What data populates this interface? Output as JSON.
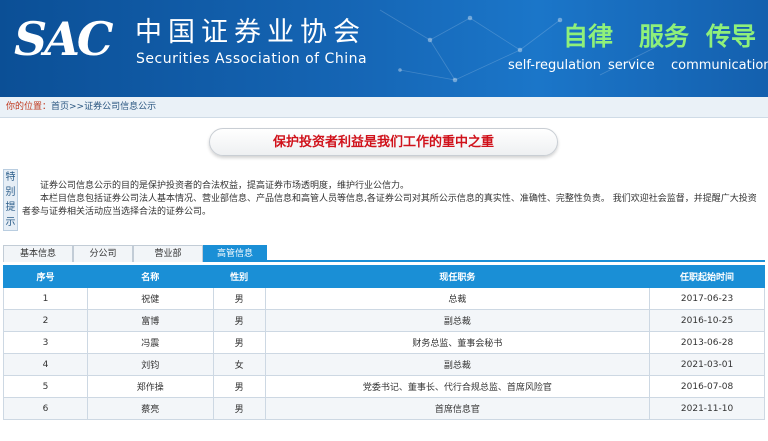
{
  "header": {
    "logo": "SAC",
    "name_cn": "中国证券业协会",
    "name_en": "Securities Association of China",
    "slogans": [
      {
        "cn": "自律",
        "en": "self-regulation"
      },
      {
        "cn": "服务",
        "en": "service"
      },
      {
        "cn": "传导",
        "en": "communication"
      }
    ]
  },
  "breadcrumb": {
    "prefix": "你的位置：",
    "path": "首页>>证券公司信息公示"
  },
  "motto": "保护投资者利益是我们工作的重中之重",
  "notice": {
    "tag": [
      "特",
      "别",
      "提",
      "示"
    ],
    "lines": [
      "证券公司信息公示的目的是保护投资者的合法权益，提高证券市场透明度，维护行业公信力。",
      "本栏目信息包括证券公司法人基本情况、营业部信息、产品信息和高管人员等信息,各证券公司对其所公示信息的真实性、准确性、完整性负责。 我们欢迎社会监督，并提醒广大投资者参与证券相关活动应当选择合法的证券公司。"
    ]
  },
  "tabs": [
    {
      "label": "基本信息",
      "active": false
    },
    {
      "label": "分公司",
      "active": false
    },
    {
      "label": "营业部",
      "active": false
    },
    {
      "label": "高管信息",
      "active": true
    }
  ],
  "table": {
    "headers": [
      "序号",
      "名称",
      "性别",
      "现任职务",
      "任职起始时间"
    ],
    "rows": [
      [
        "1",
        "祝健",
        "男",
        "总裁",
        "2017-06-23"
      ],
      [
        "2",
        "富博",
        "男",
        "副总裁",
        "2016-10-25"
      ],
      [
        "3",
        "冯震",
        "男",
        "财务总监、董事会秘书",
        "2013-06-28"
      ],
      [
        "4",
        "刘钧",
        "女",
        "副总裁",
        "2021-03-01"
      ],
      [
        "5",
        "郑作操",
        "男",
        "党委书记、董事长、代行合规总监、首席风险官",
        "2016-07-08"
      ],
      [
        "6",
        "蔡亮",
        "男",
        "首席信息官",
        "2021-11-10"
      ]
    ]
  },
  "colors": {
    "banner": "#1565b4",
    "slogan": "#8ff07a",
    "accent": "#1a8fd6",
    "motto": "#d0121b"
  }
}
